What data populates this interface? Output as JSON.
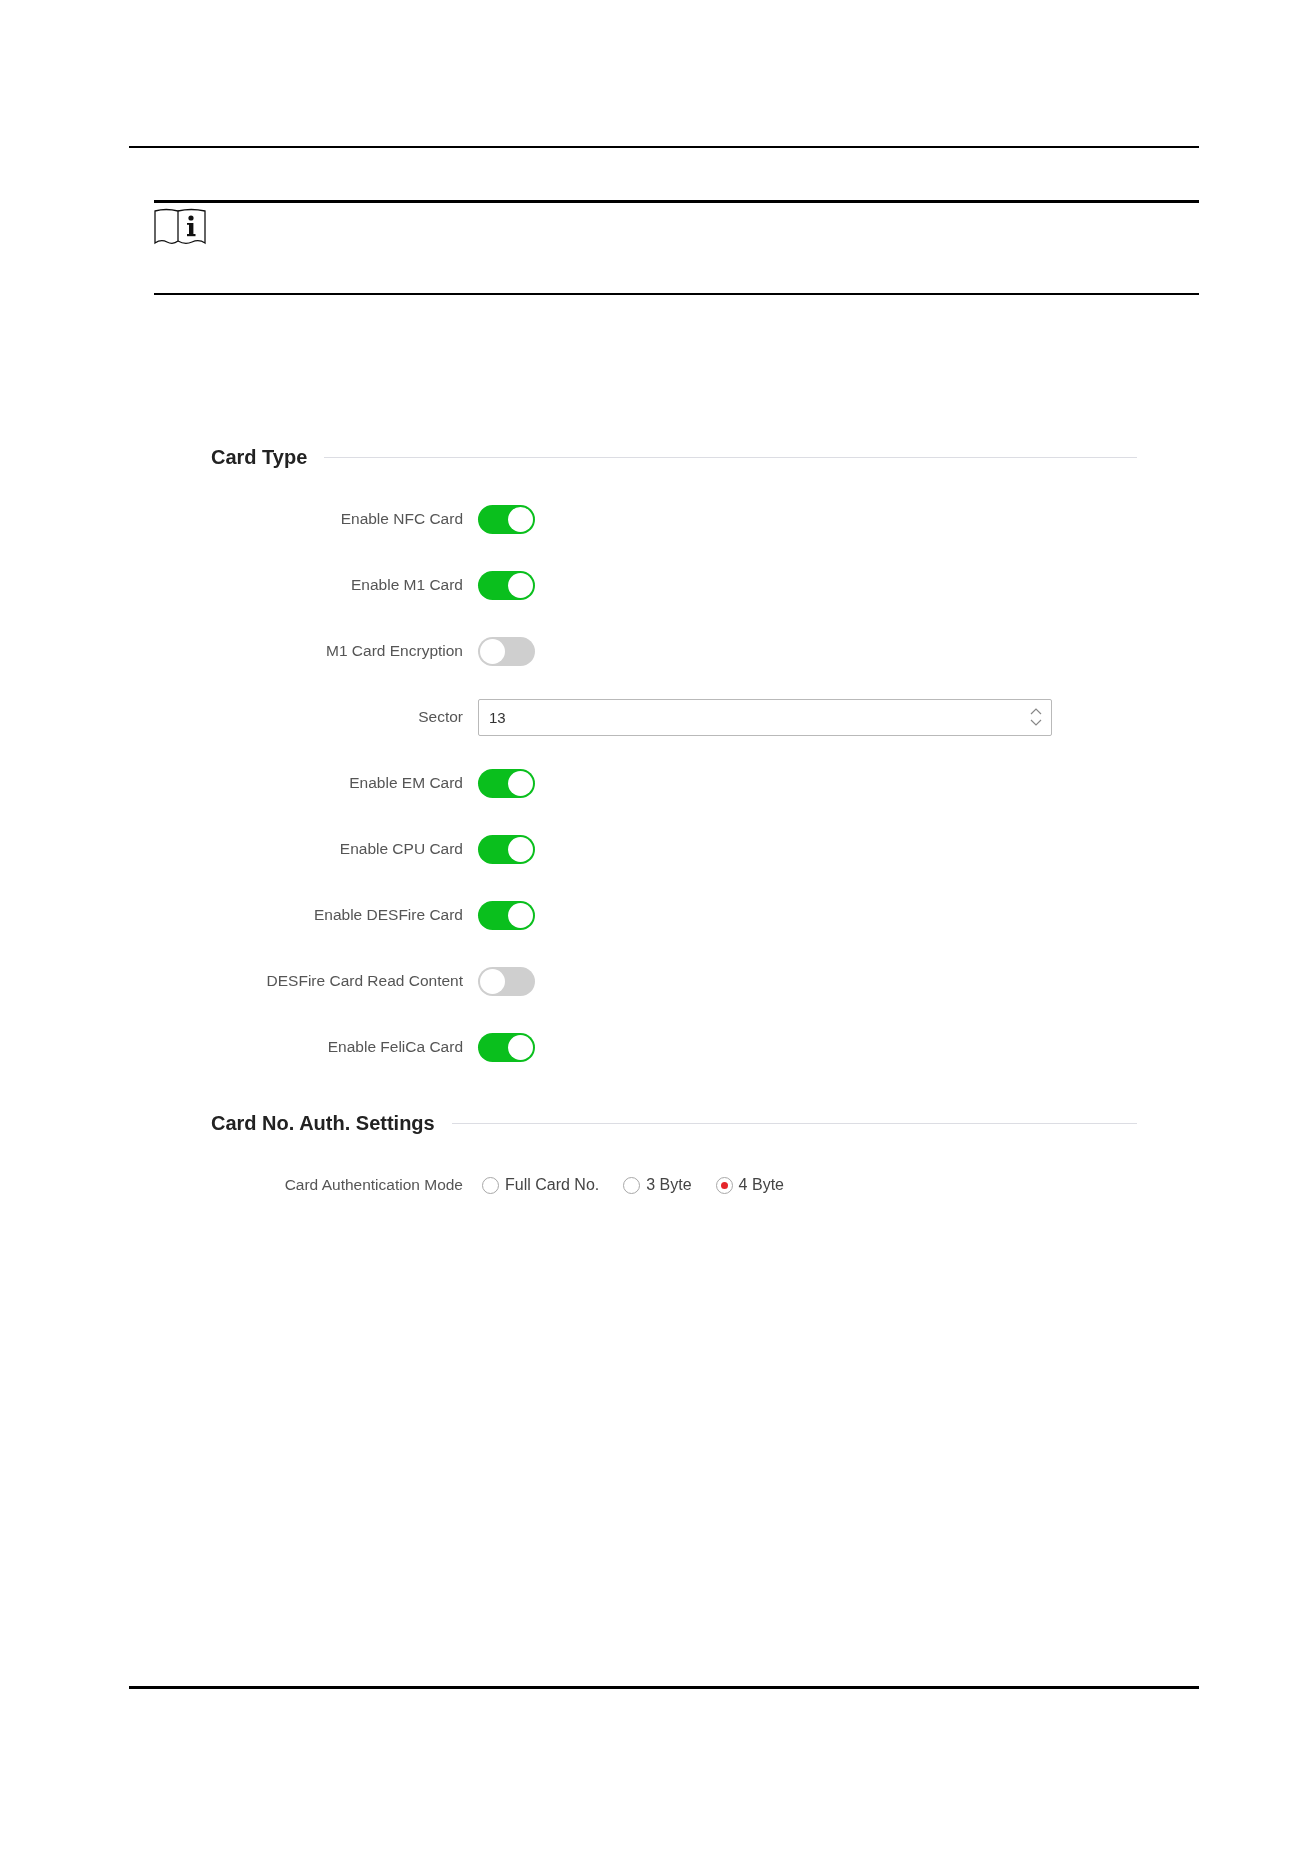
{
  "sections": [
    {
      "title": "Card Type",
      "rows": [
        {
          "kind": "toggle",
          "label": "Enable NFC Card",
          "on": true
        },
        {
          "kind": "toggle",
          "label": "Enable M1 Card",
          "on": true
        },
        {
          "kind": "toggle",
          "label": "M1 Card Encryption",
          "on": false
        },
        {
          "kind": "number",
          "label": "Sector",
          "value": "13"
        },
        {
          "kind": "toggle",
          "label": "Enable EM Card",
          "on": true
        },
        {
          "kind": "toggle",
          "label": "Enable CPU Card",
          "on": true
        },
        {
          "kind": "toggle",
          "label": "Enable DESFire Card",
          "on": true
        },
        {
          "kind": "toggle",
          "label": "DESFire Card Read Content",
          "on": false
        },
        {
          "kind": "toggle",
          "label": "Enable FeliCa Card",
          "on": true
        }
      ]
    },
    {
      "title": "Card No. Auth. Settings",
      "rows": [
        {
          "kind": "radio",
          "label": "Card Authentication Mode",
          "options": [
            {
              "label": "Full Card No.",
              "selected": false
            },
            {
              "label": "3 Byte",
              "selected": false
            },
            {
              "label": "4 Byte",
              "selected": true
            }
          ]
        }
      ]
    }
  ]
}
